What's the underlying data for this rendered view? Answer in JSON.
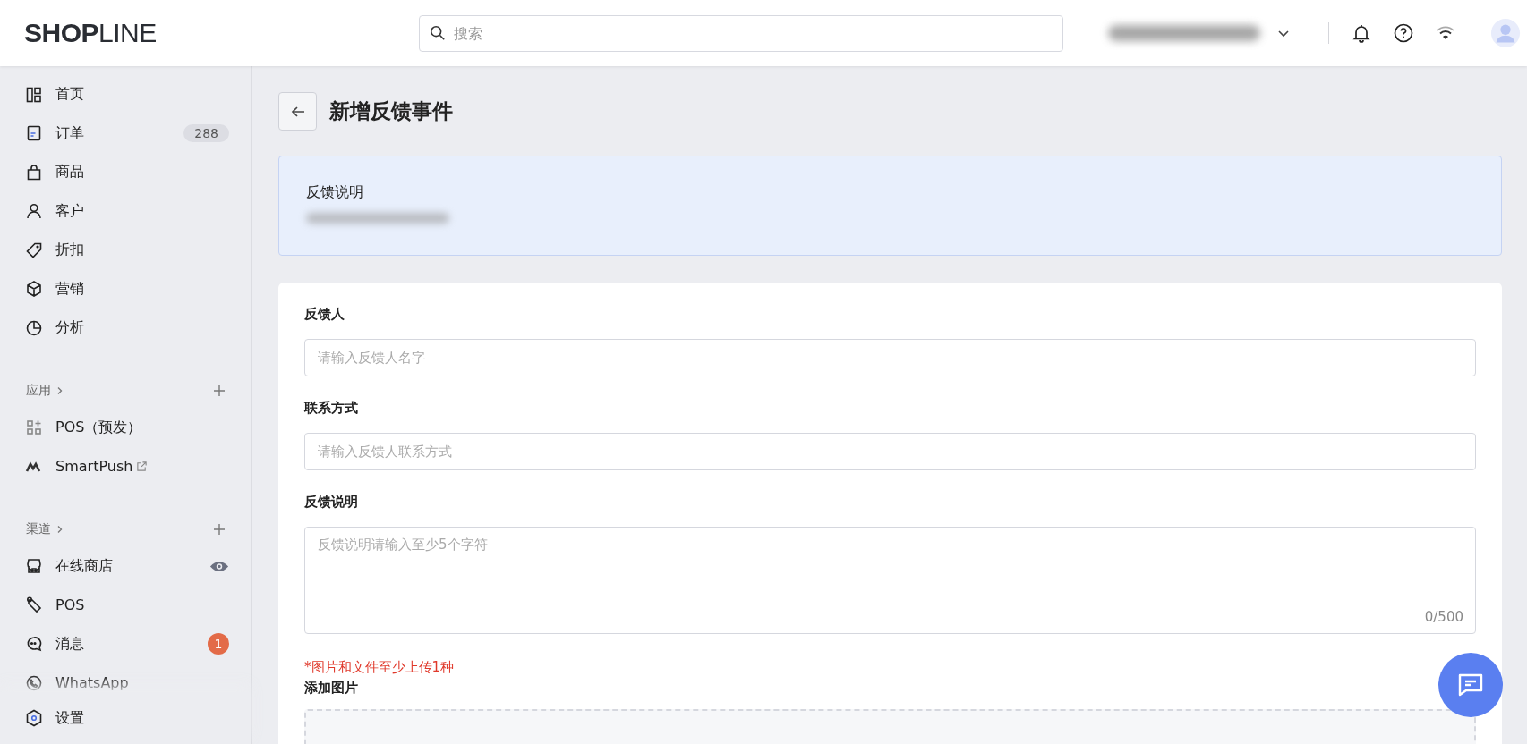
{
  "header": {
    "logo": "**SHOP**LINE",
    "search": {
      "placeholder": "搜索"
    }
  },
  "sidebar": {
    "main_items": [
      {
        "label": "首页"
      },
      {
        "label": "订单",
        "badge": {
          "text": "288",
          "kind": "count"
        }
      },
      {
        "label": "商品"
      },
      {
        "label": "客户"
      },
      {
        "label": "折扣"
      },
      {
        "label": "营销"
      },
      {
        "label": "分析"
      }
    ],
    "sections": [
      {
        "title": "应用",
        "items": [
          {
            "label": "POS（预发）",
            "kind": "plain"
          },
          {
            "label": "SmartPush",
            "kind": "external"
          }
        ]
      },
      {
        "title": "渠道",
        "items": [
          {
            "label": "在线商店",
            "kind": "preview"
          },
          {
            "label": "POS",
            "kind": "plain"
          },
          {
            "label": "消息",
            "kind": "plain",
            "badge": {
              "text": "1",
              "kind": "alert"
            }
          },
          {
            "label": "WhatsApp",
            "kind": "plain"
          }
        ]
      }
    ],
    "settings": {
      "label": "设置"
    }
  },
  "page": {
    "title": "新增反馈事件",
    "notice": {
      "title": "反馈说明"
    },
    "form": {
      "fields": [
        {
          "label": "反馈人",
          "placeholder": "请输入反馈人名字",
          "kind": "input"
        },
        {
          "label": "联系方式",
          "placeholder": "请输入反馈人联系方式",
          "kind": "input"
        },
        {
          "label": "反馈说明",
          "placeholder": "反馈说明请输入至少5个字符",
          "kind": "textarea",
          "counter": "0/500"
        }
      ],
      "upload_note": "*图片和文件至少上传1种",
      "upload_label": "添加图片"
    }
  }
}
